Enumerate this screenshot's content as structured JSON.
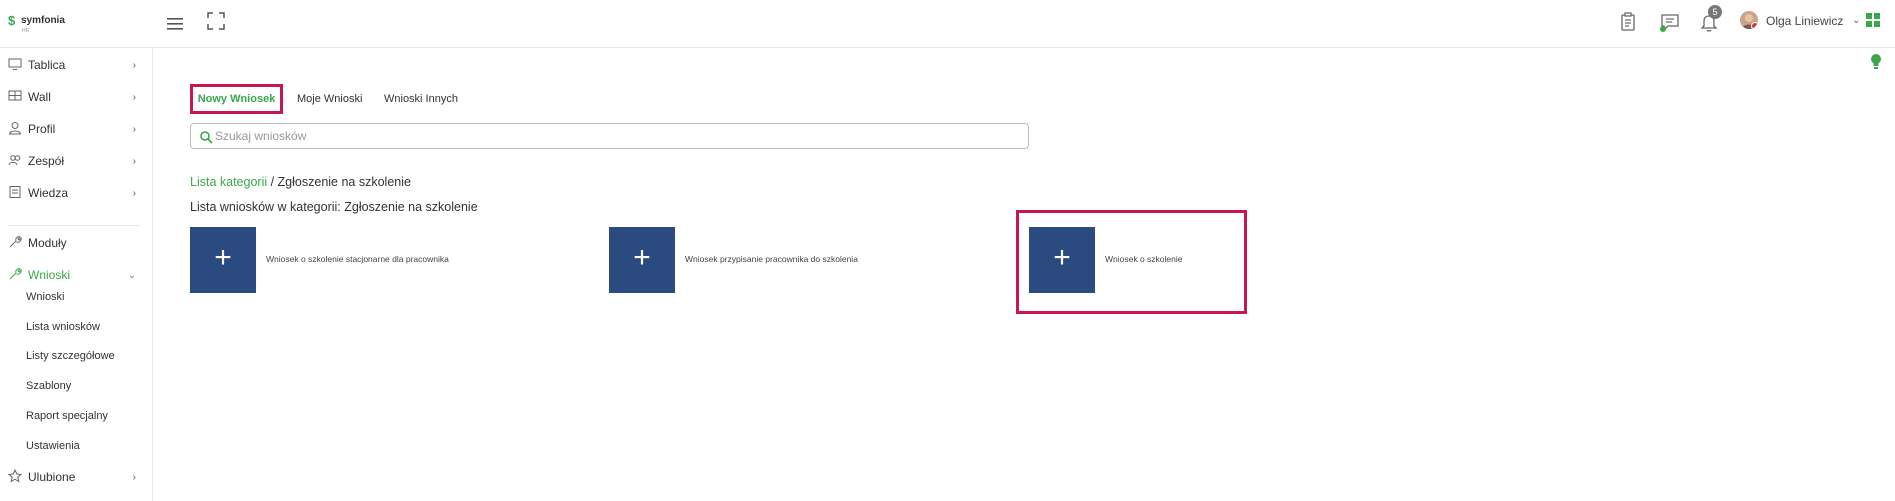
{
  "app": {
    "logo_text": "symfonia",
    "logo_sub": "HR"
  },
  "topbar": {
    "icons": [
      "menu-icon",
      "fullscreen-icon",
      "clipboard-icon",
      "chat-icon",
      "bell-icon",
      "apps-grid-icon"
    ],
    "notification_count": "5",
    "user_name": "Olga Liniewicz"
  },
  "sidebar": {
    "items": [
      {
        "label": "Tablica",
        "icon": "monitor-icon"
      },
      {
        "label": "Wall",
        "icon": "wall-icon"
      },
      {
        "label": "Profil",
        "icon": "user-icon"
      },
      {
        "label": "Zespół",
        "icon": "team-icon"
      },
      {
        "label": "Wiedza",
        "icon": "book-icon"
      },
      {
        "label": "Moduły",
        "icon": "wrench-icon"
      },
      {
        "label": "Wnioski",
        "icon": "wrench-icon"
      },
      {
        "label": "Ulubione",
        "icon": "star-icon"
      }
    ],
    "subitems": [
      "Wnioski",
      "Lista wniosków",
      "Listy szczegółowe",
      "Szablony",
      "Raport specjalny",
      "Ustawienia"
    ],
    "active_item": "Wnioski",
    "accent": "#3aa84a"
  },
  "tabs": [
    {
      "label": "Nowy Wniosek"
    },
    {
      "label": "Moje Wnioski"
    },
    {
      "label": "Wnioski Innych"
    }
  ],
  "search": {
    "placeholder": "Szukaj wniosków",
    "value": ""
  },
  "breadcrumb": {
    "link": "Lista kategorii",
    "separator": " / ",
    "current": "Zgłoszenie na szkolenie"
  },
  "list_title": "Lista wniosków w kategorii: Zgłoszenie na szkolenie",
  "cards": [
    {
      "label": "Wniosek o szkolenie stacjonarne dla pracownika"
    },
    {
      "label": "Wniosek przypisanie pracownika do szkolenia"
    },
    {
      "label": "Wniosek o szkolenie"
    }
  ],
  "card_plus": "+",
  "colors": {
    "tile": "#2b4a80",
    "highlight": "#c8174f",
    "green": "#3aa84a"
  }
}
